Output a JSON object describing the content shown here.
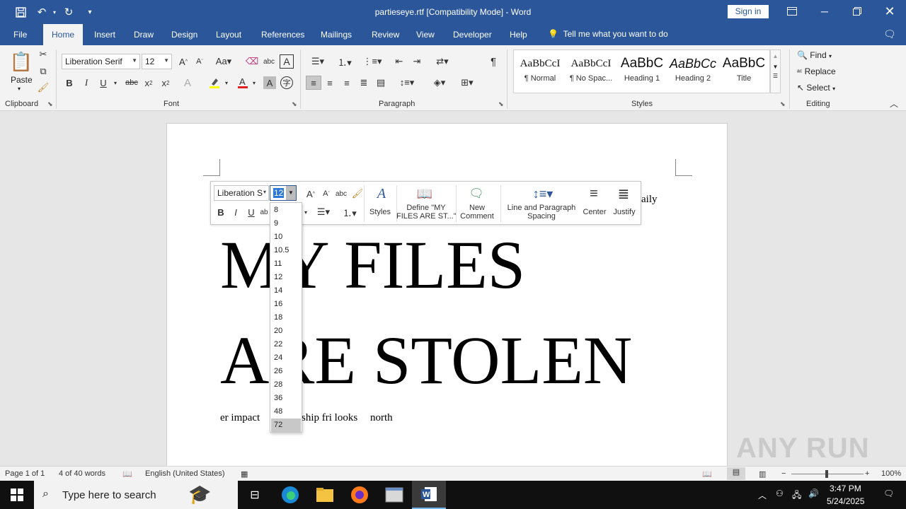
{
  "window": {
    "title": "partieseye.rtf [Compatibility Mode]  -  Word",
    "sign_in": "Sign in"
  },
  "tabs": [
    "File",
    "Home",
    "Insert",
    "Draw",
    "Design",
    "Layout",
    "References",
    "Mailings",
    "Review",
    "View",
    "Developer",
    "Help"
  ],
  "tell_me": "Tell me what you want to do",
  "clipboard": {
    "paste": "Paste",
    "label": "Clipboard"
  },
  "font": {
    "name": "Liberation Serif",
    "size": "12",
    "label": "Font"
  },
  "paragraph": {
    "label": "Paragraph"
  },
  "styles": {
    "label": "Styles",
    "items": [
      {
        "sample": "AaBbCcI",
        "name": "¶ Normal"
      },
      {
        "sample": "AaBbCcI",
        "name": "¶ No Spac..."
      },
      {
        "sample": "AaBbC",
        "name": "Heading 1"
      },
      {
        "sample": "AaBbCc",
        "name": "Heading 2"
      },
      {
        "sample": "AaBbC",
        "name": "Title"
      }
    ]
  },
  "editing": {
    "label": "Editing",
    "find": "Find",
    "replace": "Replace",
    "select": "Select"
  },
  "document": {
    "line_top_end": "aily",
    "heading_line1": "MY FILES",
    "heading_line2": "ARE STOLEN",
    "body_part1": "er impact",
    "body_part2": "ship fri looks",
    "body_part3": "north"
  },
  "mini_toolbar": {
    "font_name": "Liberation S",
    "font_size": "12",
    "styles": "Styles",
    "define_line1": "Define \"MY",
    "define_line2": "FILES ARE ST...\"",
    "new_comment_line1": "New",
    "new_comment_line2": "Comment",
    "spacing_line1": "Line and Paragraph",
    "spacing_line2": "Spacing",
    "center": "Center",
    "justify": "Justify"
  },
  "font_sizes": [
    "8",
    "9",
    "10",
    "10.5",
    "11",
    "12",
    "14",
    "16",
    "18",
    "20",
    "22",
    "24",
    "26",
    "28",
    "36",
    "48",
    "72"
  ],
  "font_size_highlighted": "72",
  "status": {
    "page": "Page 1 of 1",
    "words": "4 of 40 words",
    "language": "English (United States)",
    "zoom": "100%"
  },
  "taskbar": {
    "search_placeholder": "Type here to search",
    "time": "3:47 PM",
    "date": "5/24/2025"
  },
  "watermark": "ANY RUN",
  "colors": {
    "word_blue": "#2b579a",
    "ribbon_bg": "#f3f3f3",
    "taskbar": "#101010"
  }
}
